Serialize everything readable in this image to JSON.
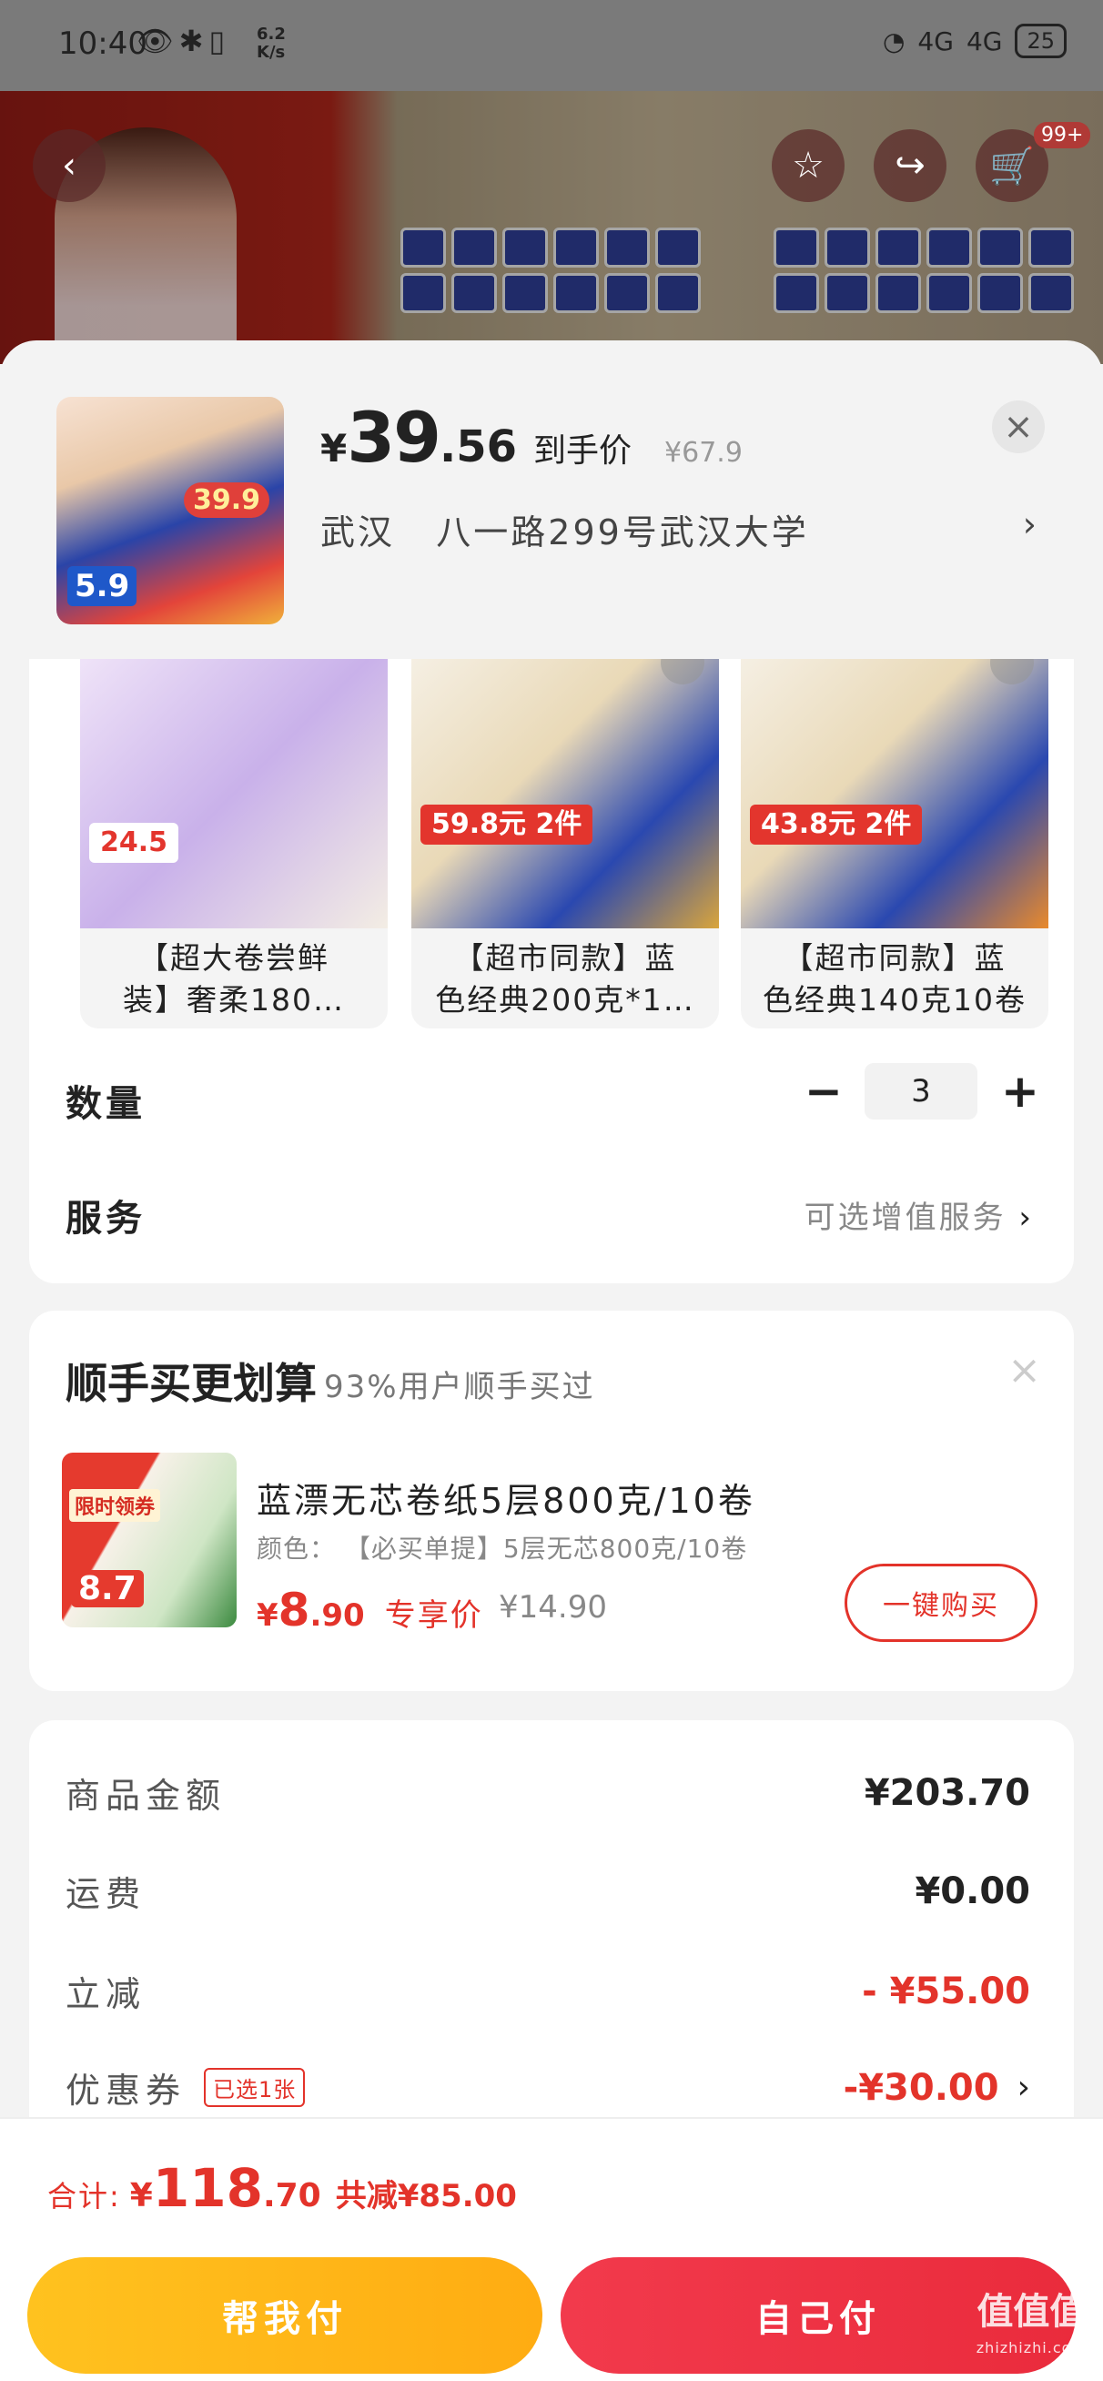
{
  "status_bar": {
    "time": "10:40",
    "net_speed_value": "6.2",
    "net_speed_unit": "K/s",
    "signal_1": "4G",
    "signal_2": "4G",
    "battery": "25"
  },
  "header": {
    "cart_count": "99+"
  },
  "product": {
    "price_yen": "¥",
    "price_int": "39",
    "price_dec": ".56",
    "price_label": "到手价",
    "original_price": "¥67.9",
    "thumb_tag": "5.9",
    "thumb_badge": "39.9",
    "address_city": "武汉",
    "address_detail": "八一路299号武汉大学"
  },
  "variants": [
    {
      "name_line1": "【超大卷尝鲜",
      "name_line2": "装】奢柔180…",
      "price_tag": "24.5"
    },
    {
      "name_line1": "【超市同款】蓝",
      "name_line2": "色经典200克*1…",
      "price_tag": "59.8元 2件"
    },
    {
      "name_line1": "【超市同款】蓝",
      "name_line2": "色经典140克10卷",
      "price_tag": "43.8元 2件"
    }
  ],
  "quantity": {
    "label": "数量",
    "value": "3",
    "minus": "−",
    "plus": "+"
  },
  "service": {
    "label": "服务",
    "value": "可选增值服务"
  },
  "upsell": {
    "title": "顺手买更划算",
    "subtitle": "93%用户顺手买过",
    "thumb_tag": "限时领券",
    "thumb_num": "8.7",
    "item_name": "蓝漂无芯卷纸5层800克/10卷",
    "item_spec": "颜色： 【必买单提】5层无芯800克/10卷",
    "price_yen": "¥",
    "price_int": "8",
    "price_dec": ".90",
    "price_label": "专享价",
    "original_price": "¥14.90",
    "buy_label": "一键购买"
  },
  "summary": {
    "rows": [
      {
        "label": "商品金额",
        "value": "¥203.70"
      },
      {
        "label": "运费",
        "value": "¥0.00"
      },
      {
        "label": "立减",
        "value": "- ¥55.00"
      },
      {
        "label": "优惠券",
        "value": "-¥30.00",
        "chip": "已选1张"
      }
    ]
  },
  "footer": {
    "total_label": "合计:",
    "total_yen": "¥",
    "total_int": "118",
    "total_dec": ".70",
    "total_saved": "共减¥85.00",
    "pay_help_label": "帮我付",
    "pay_self_label": "自己付"
  },
  "watermark": {
    "text": "值值值",
    "domain": "zhizhizhi.com"
  },
  "colors": {
    "accent_red": "#e3332a",
    "pay_help": "#ffc21f",
    "pay_self": "#f23a4c"
  }
}
